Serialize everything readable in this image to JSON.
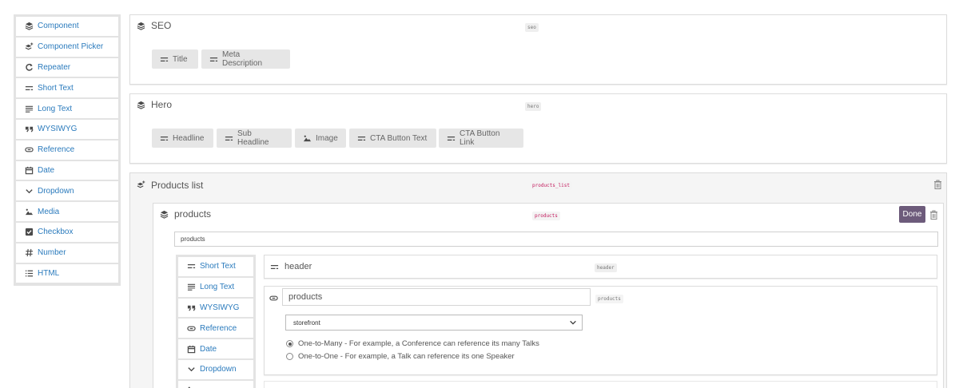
{
  "palette": {
    "items": [
      {
        "label": "Component",
        "icon": "layers-icon"
      },
      {
        "label": "Component Picker",
        "icon": "layers-plus-icon"
      },
      {
        "label": "Repeater",
        "icon": "repeat-icon"
      },
      {
        "label": "Short Text",
        "icon": "short-text-icon"
      },
      {
        "label": "Long Text",
        "icon": "long-text-icon"
      },
      {
        "label": "WYSIWYG",
        "icon": "quote-icon"
      },
      {
        "label": "Reference",
        "icon": "link-icon"
      },
      {
        "label": "Date",
        "icon": "calendar-icon"
      },
      {
        "label": "Dropdown",
        "icon": "chevron-down-icon"
      },
      {
        "label": "Media",
        "icon": "image-icon"
      },
      {
        "label": "Checkbox",
        "icon": "checkbox-icon"
      },
      {
        "label": "Number",
        "icon": "hash-icon"
      },
      {
        "label": "HTML",
        "icon": "list-icon"
      }
    ]
  },
  "seo": {
    "title": "SEO",
    "api_id": "seo",
    "fields": [
      "Title",
      "Meta Description"
    ]
  },
  "hero": {
    "title": "Hero",
    "api_id": "hero",
    "fields": [
      "Headline",
      "Sub Headline",
      "Image",
      "CTA Button Text",
      "CTA Button Link"
    ]
  },
  "products_list": {
    "title": "Products list",
    "api_id": "products_list",
    "products": {
      "title": "products",
      "api_id": "products",
      "done_label": "Done",
      "name_value": "products",
      "inner_palette": [
        {
          "label": "Short Text",
          "icon": "short-text-icon"
        },
        {
          "label": "Long Text",
          "icon": "long-text-icon"
        },
        {
          "label": "WYSIWYG",
          "icon": "quote-icon"
        },
        {
          "label": "Reference",
          "icon": "link-icon"
        },
        {
          "label": "Date",
          "icon": "calendar-icon"
        },
        {
          "label": "Dropdown",
          "icon": "chevron-down-icon"
        }
      ],
      "header_field": {
        "title": "header",
        "api_id": "header"
      },
      "reference_field": {
        "name_value": "products",
        "api_id": "products",
        "select_value": "storefront",
        "options": [
          {
            "label": "One-to-Many - For example, a Conference can reference its many Talks",
            "checked": true
          },
          {
            "label": "One-to-One - For example, a Talk can reference its one Speaker",
            "checked": false
          }
        ]
      }
    }
  }
}
